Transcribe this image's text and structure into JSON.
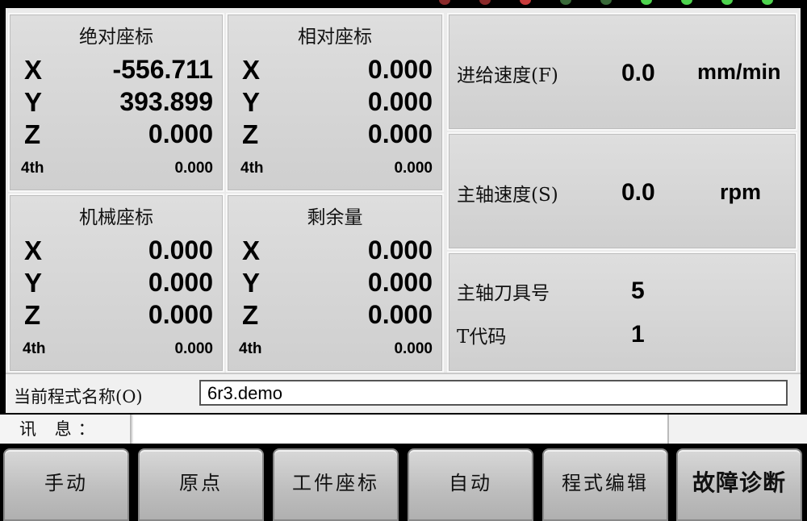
{
  "status_leds": [
    {
      "color": "#8a2a2a"
    },
    {
      "color": "#8a2a2a"
    },
    {
      "color": "#c83c3c"
    },
    {
      "color": "#3a6a3a"
    },
    {
      "color": "#3a6a3a"
    },
    {
      "color": "#4fd44f"
    },
    {
      "color": "#4fd44f"
    },
    {
      "color": "#4fd44f"
    },
    {
      "color": "#4fd44f"
    }
  ],
  "absolute": {
    "title": "绝对座标",
    "rows": [
      {
        "axis": "X",
        "value": "-556.711"
      },
      {
        "axis": "Y",
        "value": "393.899"
      },
      {
        "axis": "Z",
        "value": "0.000"
      },
      {
        "axis": "4th",
        "value": "0.000"
      }
    ]
  },
  "relative": {
    "title": "相对座标",
    "rows": [
      {
        "axis": "X",
        "value": "0.000"
      },
      {
        "axis": "Y",
        "value": "0.000"
      },
      {
        "axis": "Z",
        "value": "0.000"
      },
      {
        "axis": "4th",
        "value": "0.000"
      }
    ]
  },
  "machine": {
    "title": "机械座标",
    "rows": [
      {
        "axis": "X",
        "value": "0.000"
      },
      {
        "axis": "Y",
        "value": "0.000"
      },
      {
        "axis": "Z",
        "value": "0.000"
      },
      {
        "axis": "4th",
        "value": "0.000"
      }
    ]
  },
  "remaining": {
    "title": "剩余量",
    "rows": [
      {
        "axis": "X",
        "value": "0.000"
      },
      {
        "axis": "Y",
        "value": "0.000"
      },
      {
        "axis": "Z",
        "value": "0.000"
      },
      {
        "axis": "4th",
        "value": "0.000"
      }
    ]
  },
  "feed": {
    "label": "进给速度(F)",
    "value": "0.0",
    "unit": "mm/min"
  },
  "spindle": {
    "label": "主轴速度(S)",
    "value": "0.0",
    "unit": "rpm"
  },
  "tool": {
    "label": "主轴刀具号",
    "value": "5",
    "tcode_label": "T代码",
    "tcode_value": "1"
  },
  "program": {
    "label": "当前程式名称(O)",
    "value": "6r3.demo"
  },
  "message": {
    "label": "讯 息：",
    "text": ""
  },
  "softkeys": [
    {
      "label": "手动"
    },
    {
      "label": "原点"
    },
    {
      "label": "工件座标"
    },
    {
      "label": "自动"
    },
    {
      "label": "程式编辑"
    },
    {
      "label": "故障诊断"
    }
  ]
}
